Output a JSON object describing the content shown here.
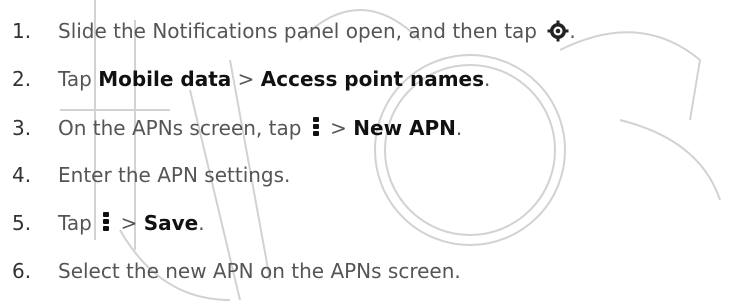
{
  "steps": [
    {
      "num": "1.",
      "text_a": "Slide the Notifications panel open, and then tap",
      "icon": "gear-icon",
      "text_b": "."
    },
    {
      "num": "2.",
      "text_a": "Tap",
      "ui_a": "Mobile data",
      "sep": ">",
      "ui_b": "Access point names",
      "end": "."
    },
    {
      "num": "3.",
      "text_a": "On the APNs screen, tap",
      "icon": "more-vert-icon",
      "sep": ">",
      "ui_b": "New APN",
      "end": "."
    },
    {
      "num": "4.",
      "text_a": "Enter the APN settings."
    },
    {
      "num": "5.",
      "text_a": "Tap",
      "icon": "more-vert-icon",
      "sep": ">",
      "ui_b": "Save",
      "end": "."
    },
    {
      "num": "6.",
      "text_a": "Select the new APN on the APNs screen."
    }
  ],
  "colors": {
    "text": "#555555",
    "ui_text": "#111111",
    "watermark": "#c8c8c8"
  }
}
